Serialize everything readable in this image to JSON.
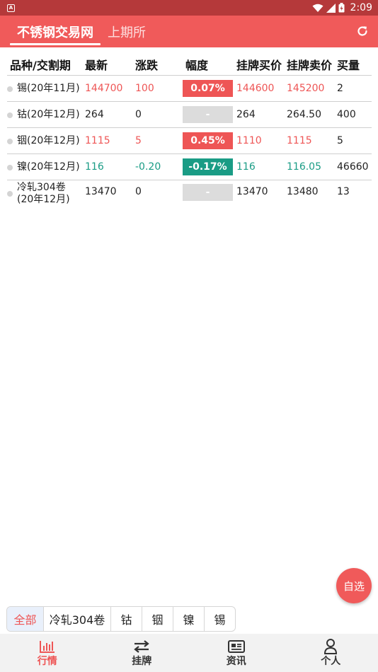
{
  "status_bar": {
    "time": "2:09"
  },
  "header": {
    "tabs": [
      {
        "label": "不锈钢交易网"
      },
      {
        "label": "上期所"
      }
    ]
  },
  "table": {
    "headers": [
      "品种/交割期",
      "最新",
      "涨跌",
      "幅度",
      "挂牌买价",
      "挂牌卖价",
      "买量"
    ],
    "rows": [
      {
        "name": "锡(20年11月)",
        "latest": "144700",
        "change": "100",
        "pct": "0.07%",
        "bid": "144600",
        "ask": "145200",
        "volume": "2",
        "trend": "up"
      },
      {
        "name": "钴(20年12月)",
        "latest": "264",
        "change": "0",
        "pct": "-",
        "bid": "264",
        "ask": "264.50",
        "volume": "400",
        "trend": "flat"
      },
      {
        "name": "铟(20年12月)",
        "latest": "1115",
        "change": "5",
        "pct": "0.45%",
        "bid": "1110",
        "ask": "1115",
        "volume": "5",
        "trend": "up"
      },
      {
        "name": "镍(20年12月)",
        "latest": "116",
        "change": "-0.20",
        "pct": "-0.17%",
        "bid": "116",
        "ask": "116.05",
        "volume": "46660",
        "trend": "down"
      },
      {
        "name_line1": "冷轧304卷",
        "name_line2": "(20年12月)",
        "latest": "13470",
        "change": "0",
        "pct": "-",
        "bid": "13470",
        "ask": "13480",
        "volume": "13",
        "trend": "flat"
      }
    ]
  },
  "fab": {
    "label": "自选"
  },
  "filters": [
    {
      "label": "全部"
    },
    {
      "label": "冷轧304卷"
    },
    {
      "label": "钴"
    },
    {
      "label": "铟"
    },
    {
      "label": "镍"
    },
    {
      "label": "锡"
    }
  ],
  "bottom_nav": [
    {
      "label": "行情",
      "icon": "chart-bars-icon"
    },
    {
      "label": "挂牌",
      "icon": "swap-arrows-icon"
    },
    {
      "label": "资讯",
      "icon": "newspaper-icon"
    },
    {
      "label": "个人",
      "icon": "person-icon"
    }
  ],
  "colors": {
    "brand": "#f05a5a",
    "up": "#ee5555",
    "down": "#1a9c85",
    "flat_badge": "#dcdcdc"
  }
}
